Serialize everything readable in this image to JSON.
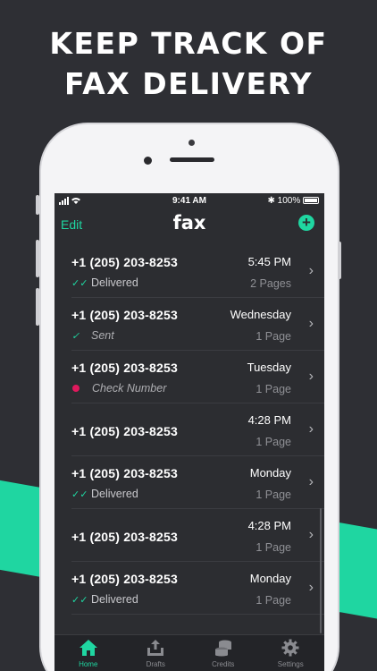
{
  "headline": {
    "line1": "KEEP TRACK OF",
    "line2": "FAX DELIVERY"
  },
  "colors": {
    "accent": "#1fd6a1",
    "background": "#2e2f34",
    "screen": "#2c2d31",
    "error_dot": "#e0195d"
  },
  "status_bar": {
    "time": "9:41 AM",
    "battery": "100%",
    "bluetooth": "✱"
  },
  "nav": {
    "edit_label": "Edit",
    "logo": "fax",
    "add_icon": "plus-circle-icon"
  },
  "faxes": [
    {
      "number": "+1 (205) 203-8253",
      "when": "5:45 PM",
      "status": "Delivered",
      "status_icon": "double-check-icon",
      "pages": "2 Pages"
    },
    {
      "number": "+1 (205) 203-8253",
      "when": "Wednesday",
      "status": "Sent",
      "status_icon": "check-icon",
      "pages": "1 Page"
    },
    {
      "number": "+1 (205) 203-8253",
      "when": "Tuesday",
      "status": "Check Number",
      "status_icon": "error-dot-icon",
      "pages": "1 Page"
    },
    {
      "number": "+1 (205) 203-8253",
      "when": "4:28 PM",
      "status": "",
      "status_icon": "",
      "pages": "1 Page"
    },
    {
      "number": "+1 (205) 203-8253",
      "when": "Monday",
      "status": "Delivered",
      "status_icon": "double-check-icon",
      "pages": "1 Page"
    },
    {
      "number": "+1 (205) 203-8253",
      "when": "4:28 PM",
      "status": "",
      "status_icon": "",
      "pages": "1 Page"
    },
    {
      "number": "+1 (205) 203-8253",
      "when": "Monday",
      "status": "Delivered",
      "status_icon": "double-check-icon",
      "pages": "1 Page"
    }
  ],
  "tabs": [
    {
      "label": "Home",
      "icon": "home-icon",
      "active": true
    },
    {
      "label": "Drafts",
      "icon": "upload-tray-icon",
      "active": false
    },
    {
      "label": "Credits",
      "icon": "coins-stack-icon",
      "active": false
    },
    {
      "label": "Settings",
      "icon": "gear-icon",
      "active": false
    }
  ]
}
